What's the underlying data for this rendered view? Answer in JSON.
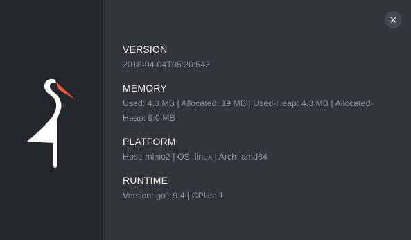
{
  "about": {
    "close_icon": "close-icon",
    "logo_icon": "minio-heron-logo",
    "sections": [
      {
        "title": "VERSION",
        "value": "2018-04-04T05:20:54Z"
      },
      {
        "title": "MEMORY",
        "value": "Used: 4.3 MB | Allocated: 19 MB | Used-Heap: 4.3 MB | Allocated-Heap: 9.0 MB"
      },
      {
        "title": "PLATFORM",
        "value": "Host: minio2 | OS: linux | Arch: amd64"
      },
      {
        "title": "RUNTIME",
        "value": "Version: go1.9.4 | CPUs: 1"
      }
    ]
  },
  "colors": {
    "brand_panel": "#23272b",
    "info_panel": "#32363b",
    "logo_accent": "#e25b3b",
    "logo_white": "#ffffff",
    "title_text": "#f1f1f1",
    "value_text": "#8d9197"
  }
}
